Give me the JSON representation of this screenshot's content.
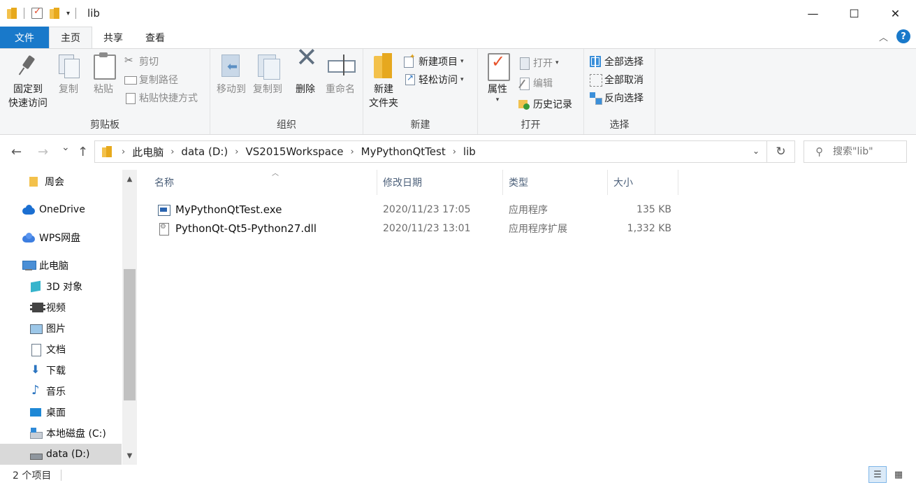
{
  "window": {
    "title": "lib",
    "quick_access_dropdown": "▾",
    "minimize": "—",
    "maximize": "☐",
    "close": "✕"
  },
  "tabs": [
    {
      "label": "文件"
    },
    {
      "label": "主页"
    },
    {
      "label": "共享"
    },
    {
      "label": "查看"
    }
  ],
  "ribbon": {
    "help": "?",
    "collapse": "︿",
    "clipboard": {
      "label": "剪贴板",
      "pin_line1": "固定到",
      "pin_line2": "快速访问",
      "copy": "复制",
      "paste": "粘贴",
      "cut": "剪切",
      "copy_path": "复制路径",
      "paste_shortcut": "粘贴快捷方式"
    },
    "organize": {
      "label": "组织",
      "move_to": "移动到",
      "copy_to": "复制到",
      "delete": "删除",
      "rename": "重命名"
    },
    "new": {
      "label": "新建",
      "new_folder_line1": "新建",
      "new_folder_line2": "文件夹",
      "new_item": "新建项目",
      "easy_access": "轻松访问"
    },
    "open": {
      "label": "打开",
      "properties": "属性",
      "open": "打开",
      "edit": "编辑",
      "history": "历史记录"
    },
    "select": {
      "label": "选择",
      "select_all": "全部选择",
      "select_none": "全部取消",
      "invert": "反向选择"
    }
  },
  "nav": {
    "back": "←",
    "forward": "→",
    "recent": "⌄",
    "up": "↑",
    "refresh": "↻",
    "address_dropdown": "⌄",
    "breadcrumb": [
      "此电脑",
      "data (D:)",
      "VS2015Workspace",
      "MyPythonQtTest",
      "lib"
    ],
    "search_placeholder": "搜索\"lib\""
  },
  "sidebar": {
    "items": [
      {
        "label": "周会",
        "icon": "folder-icon"
      },
      {
        "label": "OneDrive",
        "icon": "onedrive-icon"
      },
      {
        "label": "WPS网盘",
        "icon": "wps-cloud-icon"
      },
      {
        "label": "此电脑",
        "icon": "this-pc-icon"
      },
      {
        "label": "3D 对象",
        "icon": "3d-objects-icon"
      },
      {
        "label": "视频",
        "icon": "videos-icon"
      },
      {
        "label": "图片",
        "icon": "pictures-icon"
      },
      {
        "label": "文档",
        "icon": "documents-icon"
      },
      {
        "label": "下载",
        "icon": "downloads-icon"
      },
      {
        "label": "音乐",
        "icon": "music-icon"
      },
      {
        "label": "桌面",
        "icon": "desktop-icon"
      },
      {
        "label": "本地磁盘 (C:)",
        "icon": "local-disk-icon"
      },
      {
        "label": "data (D:)",
        "icon": "drive-icon",
        "selected": true
      }
    ],
    "scroll_up": "▲",
    "scroll_down": "▼"
  },
  "filelist": {
    "sort_indicator": "︿",
    "columns": [
      "名称",
      "修改日期",
      "类型",
      "大小"
    ],
    "rows": [
      {
        "name": "MyPythonQtTest.exe",
        "modified": "2020/11/23 17:05",
        "type": "应用程序",
        "size": "135 KB",
        "icon": "exe-file-icon"
      },
      {
        "name": "PythonQt-Qt5-Python27.dll",
        "modified": "2020/11/23 13:01",
        "type": "应用程序扩展",
        "size": "1,332 KB",
        "icon": "dll-file-icon"
      }
    ]
  },
  "status": {
    "item_count": "2 个项目",
    "details_view": "☰",
    "large_icons_view": "▦"
  },
  "colors": {
    "file_tab": "#1979ca",
    "ribbon_bg": "#f5f6f7",
    "selected_nav": "#d9d9d9",
    "column_header_text": "#4c607a"
  }
}
